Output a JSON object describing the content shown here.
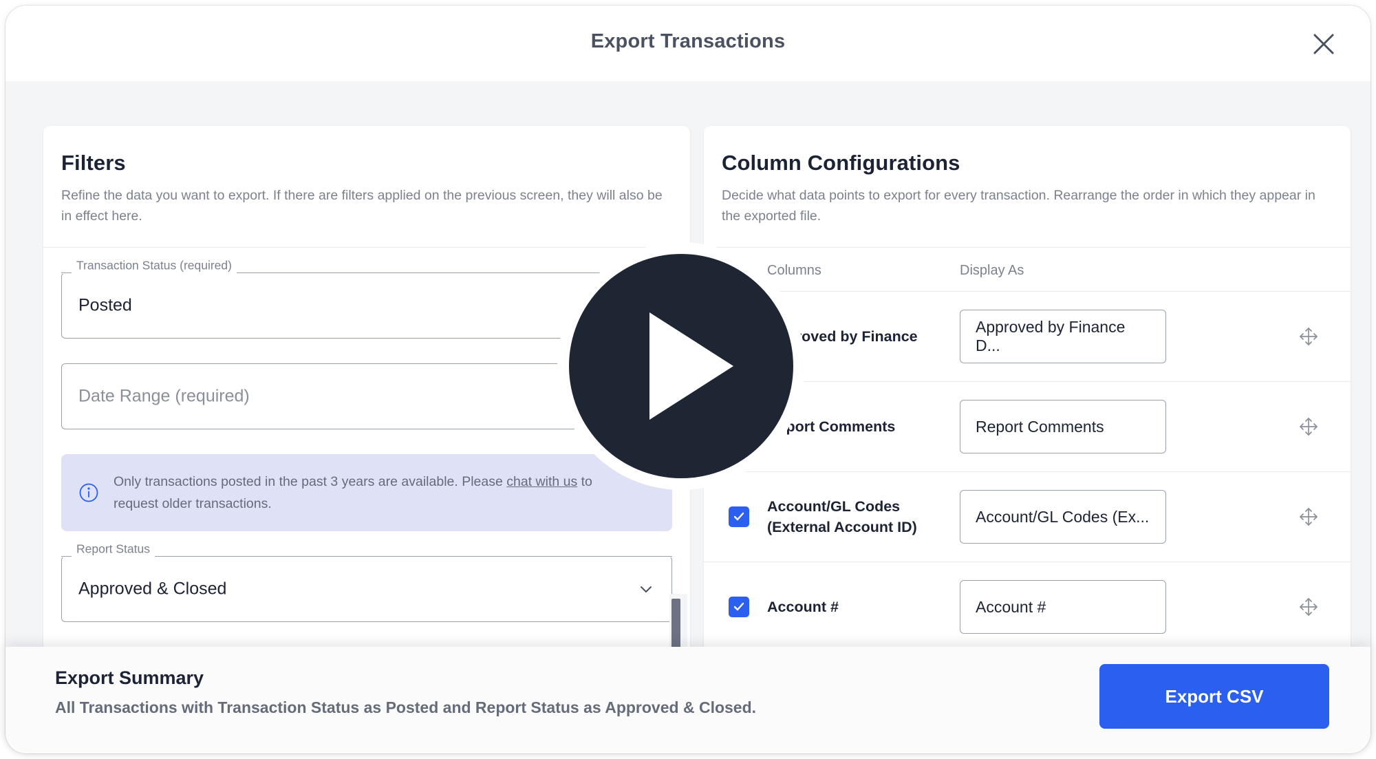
{
  "dialog": {
    "title": "Export Transactions",
    "close_icon": "close-icon"
  },
  "filters": {
    "title": "Filters",
    "description": "Refine the data you want to export. If there are filters applied on the previous screen, they will also be in effect here.",
    "transaction_status": {
      "label": "Transaction Status (required)",
      "value": "Posted"
    },
    "date_range": {
      "placeholder": "Date Range (required)",
      "value": ""
    },
    "info": {
      "icon": "info-circle-icon",
      "text_before": "Only transactions posted in the past 3 years are available. Please ",
      "link_text": "chat with us",
      "text_after": " to request older transactions."
    },
    "report_status": {
      "label": "Report Status",
      "value": "Approved & Closed",
      "chevron_icon": "chevron-down-icon"
    }
  },
  "columns_panel": {
    "title": "Column Configurations",
    "description": "Decide what data points to export for every transaction. Rearrange the order in which they appear in the exported file.",
    "headers": {
      "columns": "Columns",
      "display_as": "Display As"
    },
    "rows": [
      {
        "checked": true,
        "name": "Approved by Finance",
        "display_as": "Approved by Finance D...",
        "drag_icon": "drag-move-icon"
      },
      {
        "checked": true,
        "name": "Report Comments",
        "display_as": "Report Comments",
        "drag_icon": "drag-move-icon"
      },
      {
        "checked": true,
        "name": "Account/GL Codes (External Account ID)",
        "display_as": "Account/GL Codes (Ex...",
        "drag_icon": "drag-move-icon"
      },
      {
        "checked": true,
        "name": "Account #",
        "display_as": "Account #",
        "drag_icon": "drag-move-icon"
      }
    ]
  },
  "footer": {
    "summary_title": "Export Summary",
    "summary_text": "All Transactions with Transaction Status as Posted and Report Status as Approved & Closed.",
    "export_button": "Export CSV"
  },
  "overlay": {
    "play_icon": "play-button-icon"
  },
  "colors": {
    "accent_blue": "#2a5ff0",
    "info_banner_bg": "#dfe2f7",
    "overlay_dark": "#1f2633",
    "panel_bg": "#f4f5f7"
  }
}
